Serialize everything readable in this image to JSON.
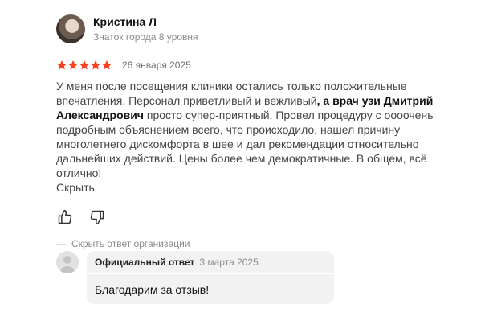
{
  "author": {
    "name": "Кристина Л",
    "level": "Знаток города 8 уровня",
    "avatar_icon": "user-photo-avatar"
  },
  "rating": {
    "stars": 5,
    "max_stars": 5,
    "star_color": "#fc3f1d",
    "date": "26 января 2025"
  },
  "review": {
    "text_part1": "У меня после посещения клиники остались только положительные впечатления. Персонал приветливый и вежливый",
    "text_highlight": ", а врач узи Дмитрий Александрович",
    "text_part2": " просто супер-приятный. Провел процедуру с оооочень подробным объяснением всего, что происходило, нашел причину многолетнего дискомфорта в шее и дал рекомендации относительно дальнейших действий. Цены более чем демократичные. В общем, всё отлично!",
    "collapse_label": "Скрыть"
  },
  "reactions": {
    "like_icon": "thumb-up-icon",
    "dislike_icon": "thumb-down-icon"
  },
  "org_toggle": {
    "dash": "—",
    "label": "Скрыть ответ организации"
  },
  "answer": {
    "label": "Официальный ответ",
    "date": "3 марта 2025",
    "text": "Благодарим за отзыв!",
    "avatar_icon": "org-avatar-placeholder-icon"
  }
}
